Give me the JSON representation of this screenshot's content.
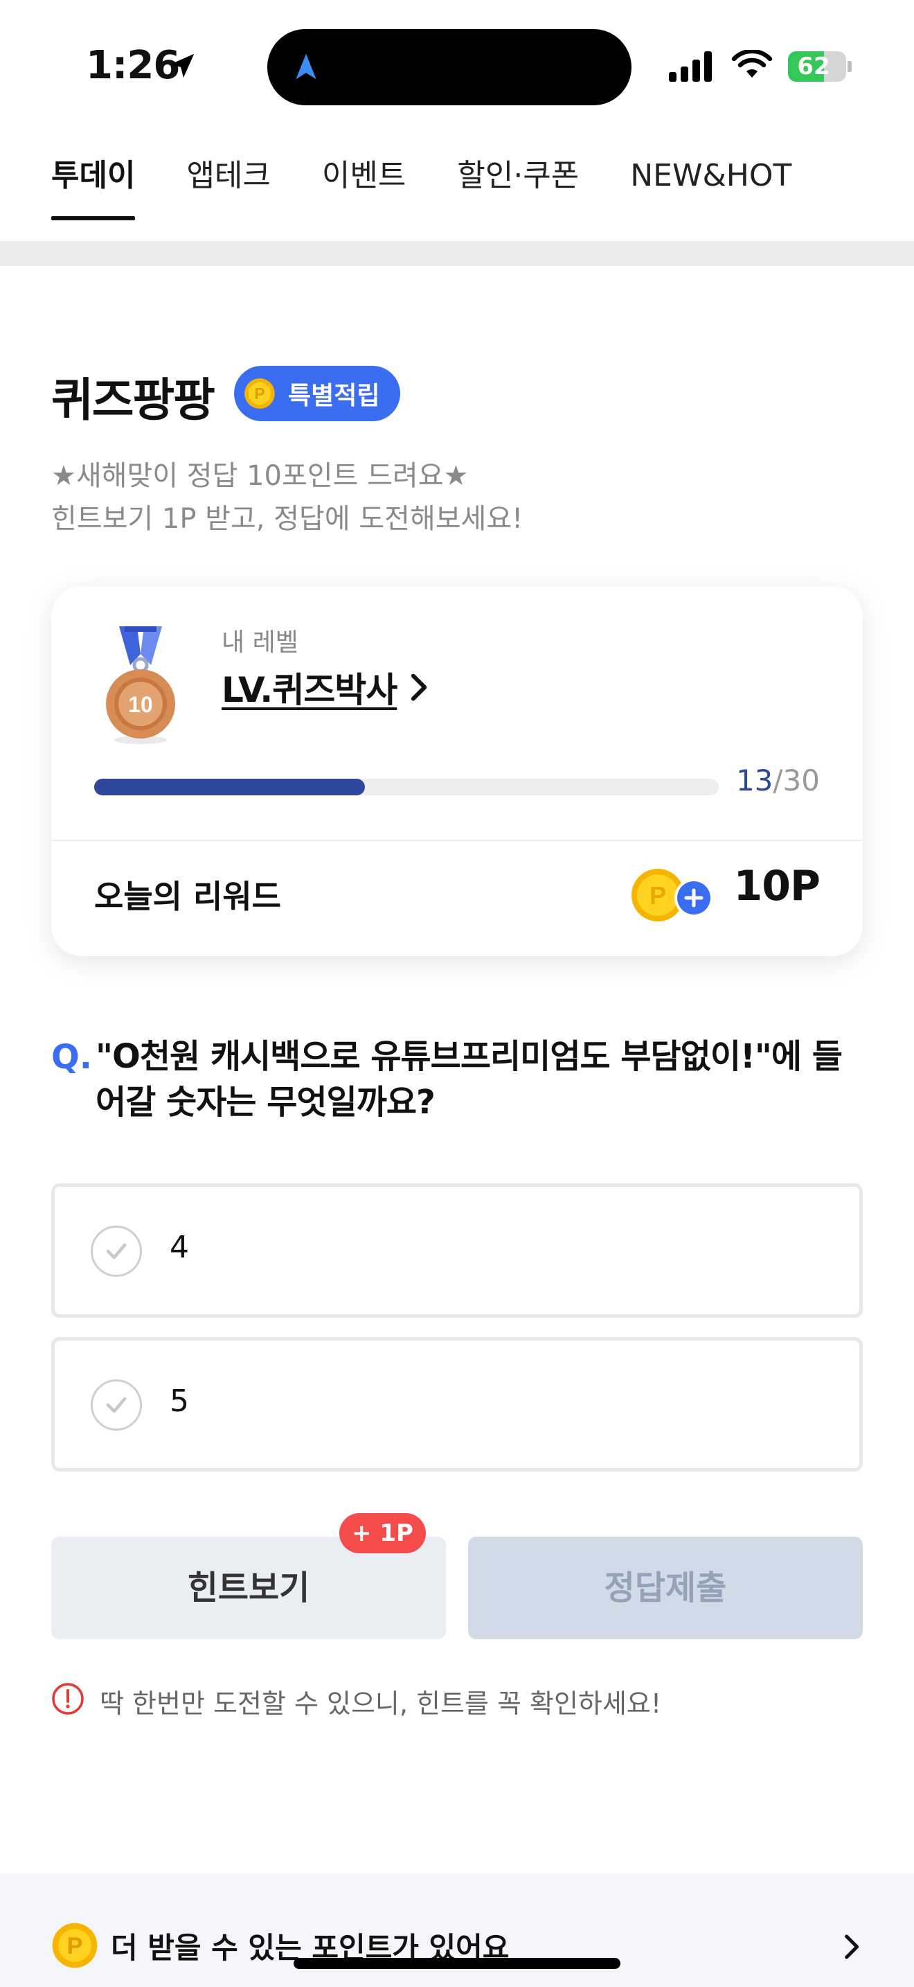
{
  "status_bar": {
    "time": "1:26",
    "battery": "62",
    "battery_level": 0.62,
    "icons": [
      "location-arrow-icon",
      "navigation-icon",
      "signal-icon",
      "wifi-icon",
      "battery-icon"
    ]
  },
  "tabs": [
    {
      "label": "투데이",
      "active": true
    },
    {
      "label": "앱테크",
      "active": false
    },
    {
      "label": "이벤트",
      "active": false
    },
    {
      "label": "할인·쿠폰",
      "active": false
    },
    {
      "label": "NEW&HOT",
      "active": false
    }
  ],
  "quiz": {
    "title": "퀴즈팡팡",
    "badge_label": "특별적립",
    "subtitle_line1": "★새해맞이 정답 10포인트 드려요★",
    "subtitle_line2": "힌트보기 1P 받고, 정답에 도전해보세요!"
  },
  "level_card": {
    "medal_number": "10",
    "level_label": "내 레벨",
    "level_name": "LV.퀴즈박사",
    "progress_current": "13",
    "progress_total": "/30",
    "progress_fraction": 0.4333,
    "reward_label": "오늘의 리워드",
    "reward_value": "10P"
  },
  "question": {
    "prefix": "Q.",
    "text": "\"O천원 캐시백으로 유튜브프리미엄도 부담없이!\"에 들어갈 숫자는 무엇일까요?",
    "options": [
      "4",
      "5"
    ]
  },
  "actions": {
    "hint_label": "힌트보기",
    "hint_badge": "+ 1P",
    "submit_label": "정답제출"
  },
  "warning": "딱 한번만 도전할 수 있으니, 힌트를 꼭 확인하세요!",
  "bottom_banner": {
    "text": "더 받을 수 있는 포인트가 있어요"
  },
  "colors": {
    "accent": "#3a6df0",
    "progress": "#2f479a",
    "badge_red": "#f44b4b",
    "battery_green": "#34c759"
  }
}
